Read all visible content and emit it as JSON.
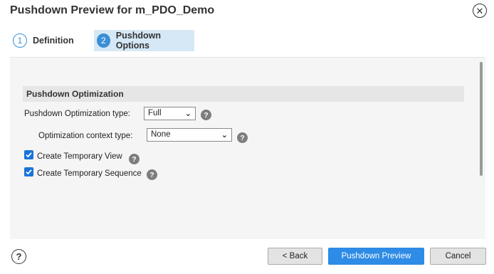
{
  "dialog": {
    "title": "Pushdown Preview for m_PDO_Demo",
    "close_icon": "close-icon"
  },
  "steps": [
    {
      "number": "1",
      "label": "Definition",
      "active": false
    },
    {
      "number": "2",
      "label": "Pushdown Options",
      "active": true
    }
  ],
  "section": {
    "header": "Pushdown Optimization",
    "fields": {
      "optimization_type": {
        "label": "Pushdown Optimization type:",
        "value": "Full"
      },
      "context_type": {
        "label": "Optimization context type:",
        "value": "None"
      }
    },
    "checkboxes": [
      {
        "label": "Create Temporary View",
        "checked": true
      },
      {
        "label": "Create Temporary Sequence",
        "checked": true
      }
    ],
    "help_glyph": "?"
  },
  "footer": {
    "help_glyph": "?",
    "back_label": "< Back",
    "preview_label": "Pushdown Preview",
    "cancel_label": "Cancel"
  },
  "colors": {
    "accent": "#3a8fd6",
    "primary_button": "#2e8be6",
    "checkbox": "#1a73d9",
    "active_step_bg": "#d6e8f6"
  }
}
